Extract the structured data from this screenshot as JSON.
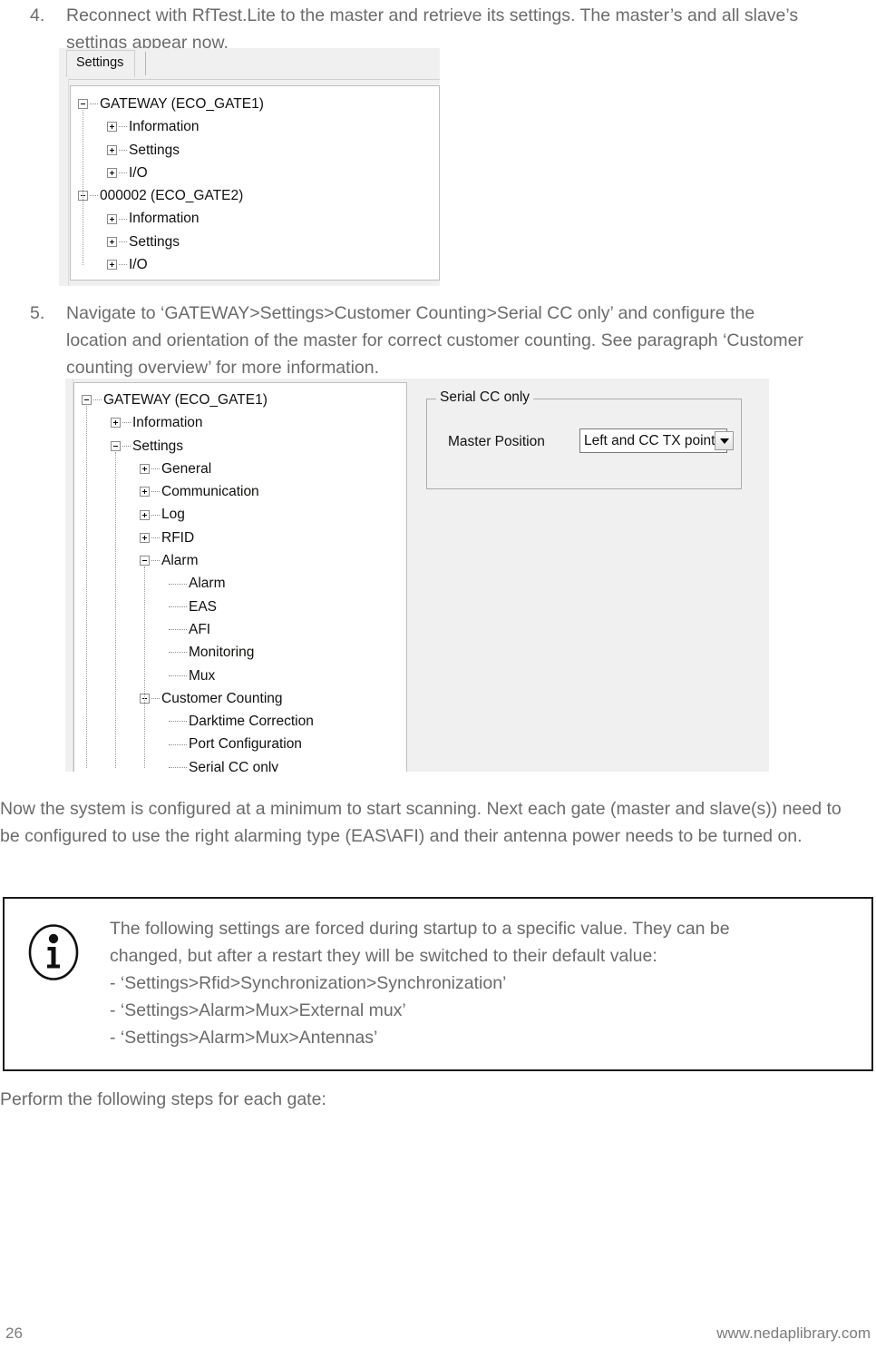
{
  "document": {
    "steps": [
      {
        "number": "4.",
        "text": "Reconnect with RfTest.Lite to the master and retrieve its settings. The master’s and all slave’s settings appear now."
      },
      {
        "number": "5.",
        "text": "Navigate to ‘GATEWAY>Settings>Customer Counting>Serial CC only’ and configure the location and orientation of the master for correct customer counting. See paragraph ‘Customer counting overview’ for more information."
      }
    ],
    "paragraph_after_figure2": "Now the system is configured at a minimum to start scanning. Next each gate (master and slave(s)) need to be configured to use the right alarming type (EAS\\AFI) and their antenna power needs to be turned on.",
    "paragraph_closing": "Perform the following steps for each gate:"
  },
  "figure1": {
    "tab_label": "Settings",
    "tree": [
      {
        "label": "GATEWAY (ECO_GATE1)",
        "depth": 0,
        "toggle": "minus"
      },
      {
        "label": "Information",
        "depth": 1,
        "toggle": "plus"
      },
      {
        "label": "Settings",
        "depth": 1,
        "toggle": "plus"
      },
      {
        "label": "I/O",
        "depth": 1,
        "toggle": "plus"
      },
      {
        "label": "000002 (ECO_GATE2)",
        "depth": 0,
        "toggle": "minus"
      },
      {
        "label": "Information",
        "depth": 1,
        "toggle": "plus"
      },
      {
        "label": "Settings",
        "depth": 1,
        "toggle": "plus"
      },
      {
        "label": "I/O",
        "depth": 1,
        "toggle": "plus"
      }
    ]
  },
  "figure2": {
    "tree": [
      {
        "label": "GATEWAY (ECO_GATE1)",
        "depth": 0,
        "toggle": "minus"
      },
      {
        "label": "Information",
        "depth": 1,
        "toggle": "plus"
      },
      {
        "label": "Settings",
        "depth": 1,
        "toggle": "minus"
      },
      {
        "label": "General",
        "depth": 2,
        "toggle": "plus"
      },
      {
        "label": "Communication",
        "depth": 2,
        "toggle": "plus"
      },
      {
        "label": "Log",
        "depth": 2,
        "toggle": "plus"
      },
      {
        "label": "RFID",
        "depth": 2,
        "toggle": "plus"
      },
      {
        "label": "Alarm",
        "depth": 2,
        "toggle": "minus"
      },
      {
        "label": "Alarm",
        "depth": 3,
        "toggle": "leaf"
      },
      {
        "label": "EAS",
        "depth": 3,
        "toggle": "leaf"
      },
      {
        "label": "AFI",
        "depth": 3,
        "toggle": "leaf"
      },
      {
        "label": "Monitoring",
        "depth": 3,
        "toggle": "leaf"
      },
      {
        "label": "Mux",
        "depth": 3,
        "toggle": "leaf"
      },
      {
        "label": "Customer Counting",
        "depth": 2,
        "toggle": "minus"
      },
      {
        "label": "Darktime Correction",
        "depth": 3,
        "toggle": "leaf"
      },
      {
        "label": "Port Configuration",
        "depth": 3,
        "toggle": "leaf"
      },
      {
        "label": "Serial CC only",
        "depth": 3,
        "toggle": "leaf"
      }
    ],
    "panel": {
      "groupbox_legend": "Serial CC only",
      "field_label": "Master Position",
      "combo_value": "Left and CC TX point",
      "combo_options": [
        "Left and CC TX point"
      ]
    }
  },
  "note": {
    "icon": "info-icon",
    "lines": [
      "The following settings are forced during startup to a specific value. They can be",
      "changed, but after a restart they will be switched to their default value:",
      "- ‘Settings>Rfid>Synchronization>Synchronization’",
      "- ‘Settings>Alarm>Mux>External mux’",
      "- ‘Settings>Alarm>Mux>Antennas’"
    ]
  },
  "footer": {
    "page_number": "26",
    "url": "www.nedaplibrary.com"
  },
  "colors": {
    "text": "#6b6b6b",
    "ui_text": "#101010",
    "ui_chrome": "#f0f0f0",
    "border": "#acacac",
    "note_border": "#1a1a1a"
  }
}
